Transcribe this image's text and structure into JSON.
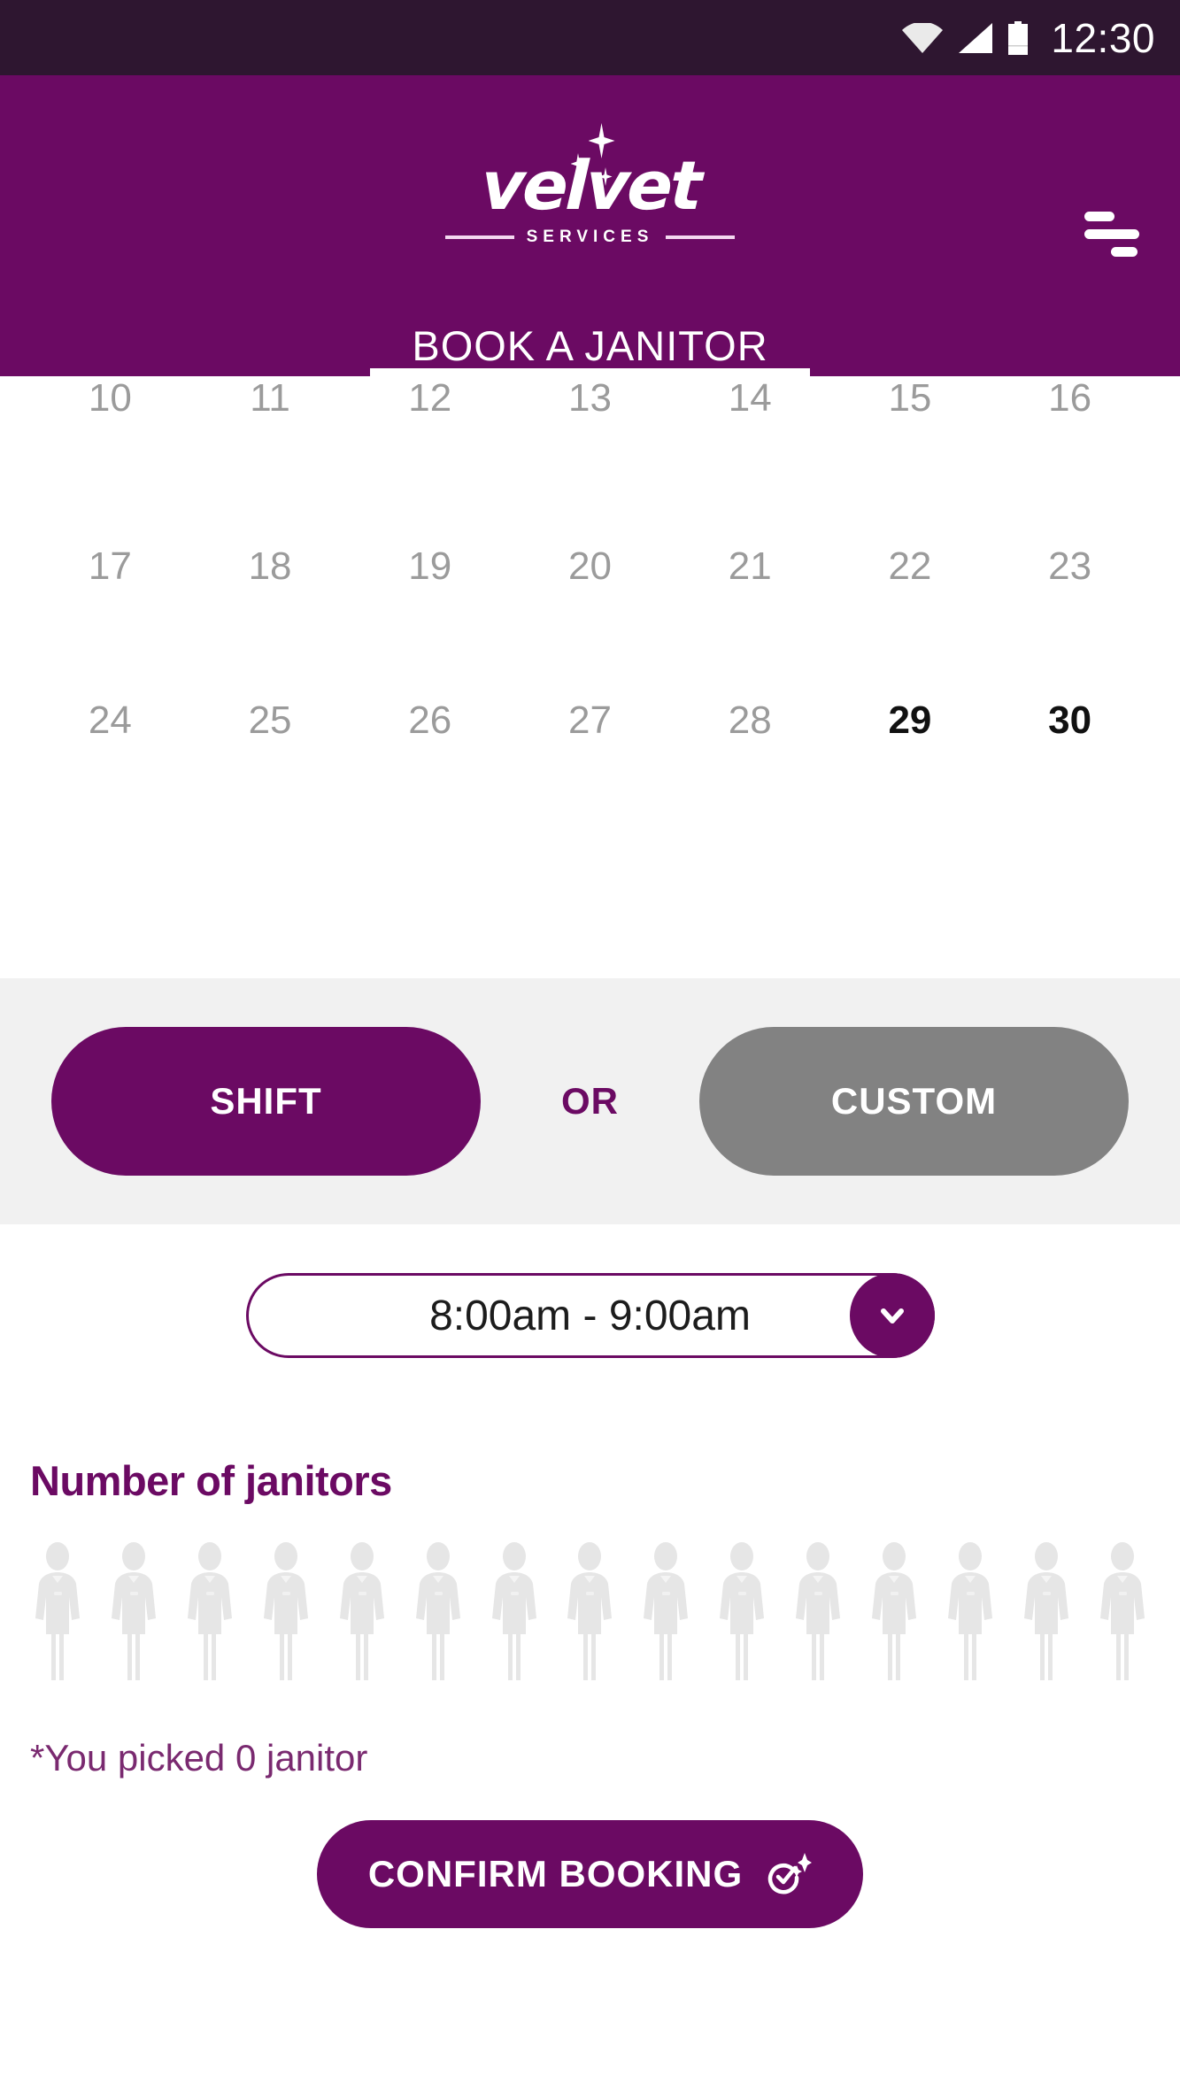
{
  "status_bar": {
    "time": "12:30",
    "icons": [
      "wifi-icon",
      "cellular-signal-icon",
      "battery-icon"
    ]
  },
  "header": {
    "brand_name": "velvet",
    "brand_tagline": "SERVICES",
    "menu_icon": "hamburger-menu-icon",
    "tab_label": "BOOK A JANITOR",
    "background_color": "#6b0a63"
  },
  "calendar": {
    "rows": [
      {
        "clipped": true,
        "days": [
          {
            "label": "10",
            "enabled": false
          },
          {
            "label": "11",
            "enabled": false
          },
          {
            "label": "12",
            "enabled": false
          },
          {
            "label": "13",
            "enabled": false
          },
          {
            "label": "14",
            "enabled": false
          },
          {
            "label": "15",
            "enabled": false
          },
          {
            "label": "16",
            "enabled": false
          }
        ]
      },
      {
        "clipped": false,
        "days": [
          {
            "label": "17",
            "enabled": false
          },
          {
            "label": "18",
            "enabled": false
          },
          {
            "label": "19",
            "enabled": false
          },
          {
            "label": "20",
            "enabled": false
          },
          {
            "label": "21",
            "enabled": false
          },
          {
            "label": "22",
            "enabled": false
          },
          {
            "label": "23",
            "enabled": false
          }
        ]
      },
      {
        "clipped": false,
        "days": [
          {
            "label": "24",
            "enabled": false
          },
          {
            "label": "25",
            "enabled": false
          },
          {
            "label": "26",
            "enabled": false
          },
          {
            "label": "27",
            "enabled": false
          },
          {
            "label": "28",
            "enabled": false
          },
          {
            "label": "29",
            "enabled": true
          },
          {
            "label": "30",
            "enabled": true
          }
        ]
      }
    ]
  },
  "mode_selector": {
    "shift_label": "SHIFT",
    "or_label": "OR",
    "custom_label": "CUSTOM",
    "selected": "SHIFT",
    "active_color": "#6b0a63",
    "inactive_color": "#828282",
    "band_background": "#f1f1f1"
  },
  "time_select": {
    "value": "8:00am - 9:00am",
    "caret_icon": "chevron-down-icon",
    "accent_color": "#6b0a63"
  },
  "janitors": {
    "title": "Number of janitors",
    "icon_count": 15,
    "icon_name": "janitor-person-icon",
    "icon_color": "#e6e6e6",
    "picked_note": "*You picked 0 janitor",
    "picked_count": 0
  },
  "confirm": {
    "label": "CONFIRM BOOKING",
    "icon": "sparkle-check-icon",
    "color": "#6b0a63"
  }
}
